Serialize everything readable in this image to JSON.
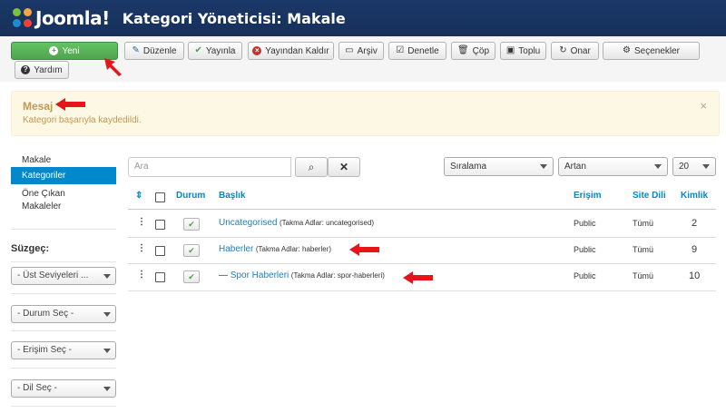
{
  "header": {
    "logo_text": "Joomla!",
    "page_title": "Kategori Yöneticisi: Makale"
  },
  "toolbar": {
    "new": "Yeni",
    "edit": "Düzenle",
    "publish": "Yayınla",
    "unpublish": "Yayından Kaldır",
    "archive": "Arşiv",
    "checkin": "Denetle",
    "trash": "Çöp",
    "batch": "Toplu",
    "rebuild": "Onar",
    "options": "Seçenekler",
    "help": "Yardım"
  },
  "message": {
    "title": "Mesaj",
    "text": "Kategori başarıyla kaydedildi.",
    "close": "×"
  },
  "sidebar": {
    "items": [
      {
        "label": "Makale"
      },
      {
        "label": "Kategoriler"
      },
      {
        "label": "Öne Çıkan Makaleler"
      }
    ],
    "filter_title": "Süzgeç:",
    "filters": [
      {
        "label": "- Üst Seviyeleri ..."
      },
      {
        "label": "- Durum Seç -"
      },
      {
        "label": "- Erişim Seç -"
      },
      {
        "label": "- Dil Seç -"
      }
    ]
  },
  "search": {
    "placeholder": "Ara",
    "sort": "Sıralama",
    "direction": "Artan",
    "limit": "20"
  },
  "table": {
    "headers": {
      "status": "Durum",
      "title": "Başlık",
      "access": "Erişim",
      "language": "Site Dili",
      "id": "Kimlik"
    },
    "rows": [
      {
        "prefix": "",
        "title": "Uncategorised",
        "alias": "(Takma Adlar: uncategorised)",
        "access": "Public",
        "language": "Tümü",
        "id": "2"
      },
      {
        "prefix": "",
        "title": "Haberler",
        "alias": "(Takma Adlar: haberler)",
        "access": "Public",
        "language": "Tümü",
        "id": "9"
      },
      {
        "prefix": "— ",
        "title": "Spor Haberleri",
        "alias": "(Takma Adlar: spor-haberleri)",
        "access": "Public",
        "language": "Tümü",
        "id": "10"
      }
    ]
  },
  "colors": {
    "header_bg": "#1a3867",
    "new_button": "#51a351",
    "active_sidebar": "#0088cc",
    "message_bg": "#fcf8e3",
    "annotation_arrow": "#e8141c"
  }
}
